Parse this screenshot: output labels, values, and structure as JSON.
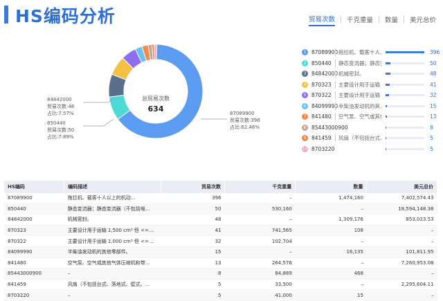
{
  "header": {
    "title": "HS编码分析"
  },
  "tabs": [
    {
      "label": "贸易次数",
      "active": true
    },
    {
      "label": "千克重量",
      "active": false
    },
    {
      "label": "数量",
      "active": false
    },
    {
      "label": "美元总价",
      "active": false
    }
  ],
  "donut": {
    "center_title": "总贸易次数",
    "center_value": "634",
    "annotations": [
      {
        "code": "84842000",
        "count_label": "贸易次数:48",
        "share_label": "占比:7.57%"
      },
      {
        "code": "850440",
        "count_label": "贸易次数:50",
        "share_label": "占比:7.89%"
      },
      {
        "code": "87089900",
        "count_label": "贸易次数:396",
        "share_label": "占比:62.46%"
      }
    ]
  },
  "chart_data": {
    "type": "pie",
    "title": "总贸易次数",
    "total": 634,
    "categories": [
      "87089900",
      "850440",
      "84842000",
      "870323",
      "870322",
      "84099990",
      "841480",
      "85443000900",
      "841459",
      "8703220"
    ],
    "values": [
      396,
      50,
      48,
      41,
      32,
      15,
      13,
      8,
      5,
      5
    ],
    "colors": [
      "#5b9bf1",
      "#4fd9d4",
      "#5a6f8c",
      "#f4bf45",
      "#8d6ef2",
      "#66c2ee",
      "#f58a4b",
      "#c7a38f",
      "#e8864d",
      "#f1a3cb"
    ]
  },
  "legend": [
    {
      "rank": "1",
      "code": "87089900",
      "desc": "拖拉机、载客十人...",
      "value": "396",
      "fraction": 1.0,
      "color": "#5b9bf1"
    },
    {
      "rank": "2",
      "code": "850440",
      "desc": "静态变流器；静态变...",
      "value": "50",
      "fraction": 0.126,
      "color": "#4fd9d4"
    },
    {
      "rank": "3",
      "code": "84842000",
      "desc": "机械密封。",
      "value": "48",
      "fraction": 0.121,
      "color": "#5a6f8c"
    },
    {
      "rank": "4",
      "code": "870323",
      "desc": "主要设计用于运输 1...",
      "value": "41",
      "fraction": 0.104,
      "color": "#f4bf45"
    },
    {
      "rank": "5",
      "code": "870322",
      "desc": "主要设计用于运输 1...",
      "value": "32",
      "fraction": 0.081,
      "color": "#8d6ef2"
    },
    {
      "rank": "6",
      "code": "84099990",
      "desc": "半柴油发动机的其...",
      "value": "15",
      "fraction": 0.038,
      "color": "#66c2ee"
    },
    {
      "rank": "7",
      "code": "841480",
      "desc": "空气泵、空气或其他...",
      "value": "13",
      "fraction": 0.033,
      "color": "#f58a4b"
    },
    {
      "rank": "8",
      "code": "85443000900",
      "desc": "",
      "value": "8",
      "fraction": 0.02,
      "color": "#c7a38f"
    },
    {
      "rank": "9",
      "code": "841459",
      "desc": "风扇（不包括台式、...",
      "value": "5",
      "fraction": 0.013,
      "color": "#e8864d"
    },
    {
      "rank": "10",
      "code": "8703220",
      "desc": "",
      "value": "5",
      "fraction": 0.013,
      "color": "#f1a3cb"
    }
  ],
  "table": {
    "columns": [
      "HS编码",
      "编码描述",
      "贸易次数",
      "千克重量",
      "数量",
      "美元总价"
    ],
    "rows": [
      [
        "87089900",
        "拖拉机、载客十人以上的机动...",
        "396",
        "–",
        "1,474,160",
        "7,402,574.43"
      ],
      [
        "850440",
        "静态变流器；静态变流器（不包括电...",
        "50",
        "530,160",
        "–",
        "18,594,148.38"
      ],
      [
        "84842000",
        "机械密封。",
        "48",
        "–",
        "1,309,176",
        "853,023.53"
      ],
      [
        "870323",
        "主要设计用于运输 1,500 cm³ 但 <=...",
        "41",
        "741,565",
        "108",
        "–"
      ],
      [
        "870322",
        "主要设计用于运输 1,000 cm³ 但 <=...",
        "32",
        "102,704",
        "–",
        "–"
      ],
      [
        "84099990",
        "半柴油发动机的其他零部件。",
        "15",
        "–",
        "16,135",
        "101,811.95"
      ],
      [
        "841480",
        "空气泵、空气或其他气体压缩机和带...",
        "13",
        "264,576",
        "–",
        "7,260,953.08"
      ],
      [
        "85443000900",
        "–",
        "8",
        "84,889",
        "468",
        "–"
      ],
      [
        "841459",
        "风扇（不包括台式、落地式、壁式、...",
        "5",
        "33,500",
        "–",
        "2,295,604.11"
      ],
      [
        "8703220",
        "–",
        "5",
        "41,000",
        "15",
        "–"
      ]
    ]
  }
}
